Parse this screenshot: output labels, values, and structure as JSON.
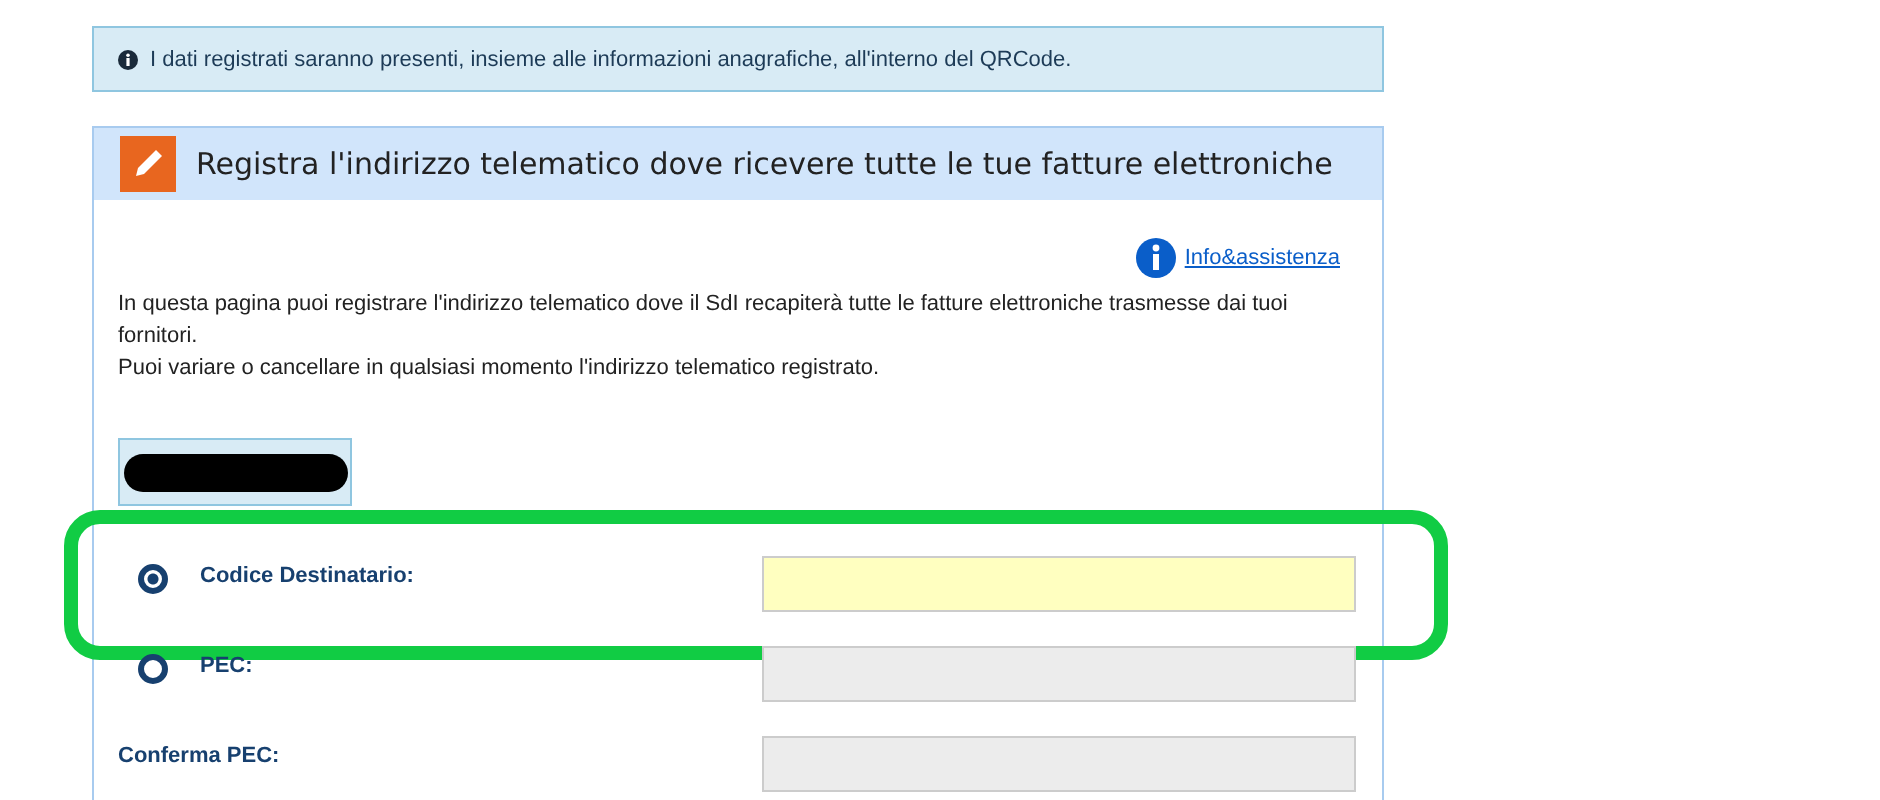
{
  "notice": {
    "text": "I dati registrati saranno presenti, insieme alle informazioni anagrafiche, all'interno del QRCode."
  },
  "panel": {
    "title": "Registra l'indirizzo telematico dove ricevere tutte le tue fatture elettroniche",
    "help_link": "Info&assistenza",
    "description": [
      "In questa pagina puoi registrare l'indirizzo telematico dove il SdI recapiterà tutte le fatture elettroniche trasmesse dai tuoi fornitori.",
      "Puoi variare o cancellare in qualsiasi momento l'indirizzo telematico registrato."
    ],
    "redacted": true,
    "fields": [
      {
        "kind": "radio",
        "label": "Codice Destinatario:",
        "selected": true,
        "disabled": false,
        "highlighted": true
      },
      {
        "kind": "radio",
        "label": "PEC:",
        "selected": false,
        "disabled": true,
        "highlighted": false
      },
      {
        "kind": "plain",
        "label": "Conferma PEC:",
        "disabled": true,
        "highlighted": false
      }
    ]
  }
}
